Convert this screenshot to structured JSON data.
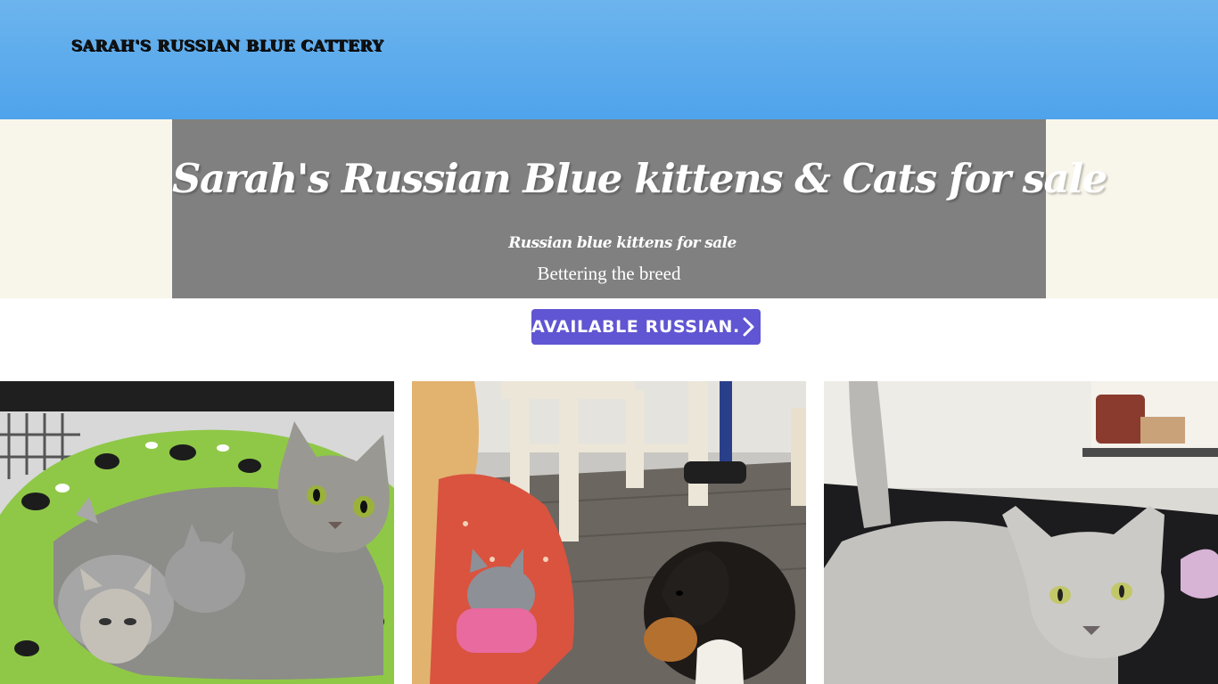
{
  "header": {
    "site_title": "Sarah's Russian Blue Cattery"
  },
  "hero": {
    "title": "Sarah's Russian Blue kittens &  Cats for sale",
    "subtitle": "Russian blue kittens for sale",
    "tagline": "Bettering the breed"
  },
  "cta": {
    "label": "AVAILABLE RUSSIAN...",
    "icon": "chevron-right-icon"
  },
  "gallery": {
    "photos": [
      {
        "subject": "mother-cat-with-kittens-photo"
      },
      {
        "subject": "child-with-kitten-and-puppy-photo"
      },
      {
        "subject": "adult-russian-blue-cat-photo"
      }
    ]
  },
  "colors": {
    "header_blue": "#5aaaee",
    "hero_gray": "#808080",
    "cream": "#f8f6ea",
    "button_purple": "#6055d2"
  }
}
